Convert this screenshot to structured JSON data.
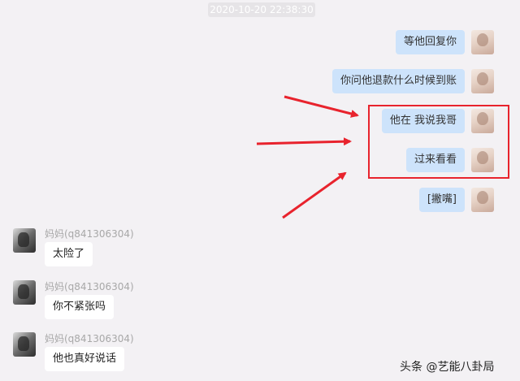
{
  "timestamp": "2020-10-20 22:38:30",
  "messages_right": [
    {
      "text": "等他回复你"
    },
    {
      "text": "你问他退款什么时候到账"
    },
    {
      "text": "他在 我说我哥"
    },
    {
      "text": "过来看看"
    },
    {
      "text": "[撇嘴]"
    }
  ],
  "messages_left": [
    {
      "sender": "妈妈(q841306304)",
      "text": "太险了"
    },
    {
      "sender": "妈妈(q841306304)",
      "text": "你不紧张吗"
    },
    {
      "sender": "妈妈(q841306304)",
      "text": "他也真好说话"
    }
  ],
  "watermark": "头条 @艺能八卦局",
  "colors": {
    "background": "#f3f1f4",
    "bubble_mine": "#cde3fb",
    "bubble_theirs": "#ffffff",
    "annotation_red": "#e8232d"
  }
}
